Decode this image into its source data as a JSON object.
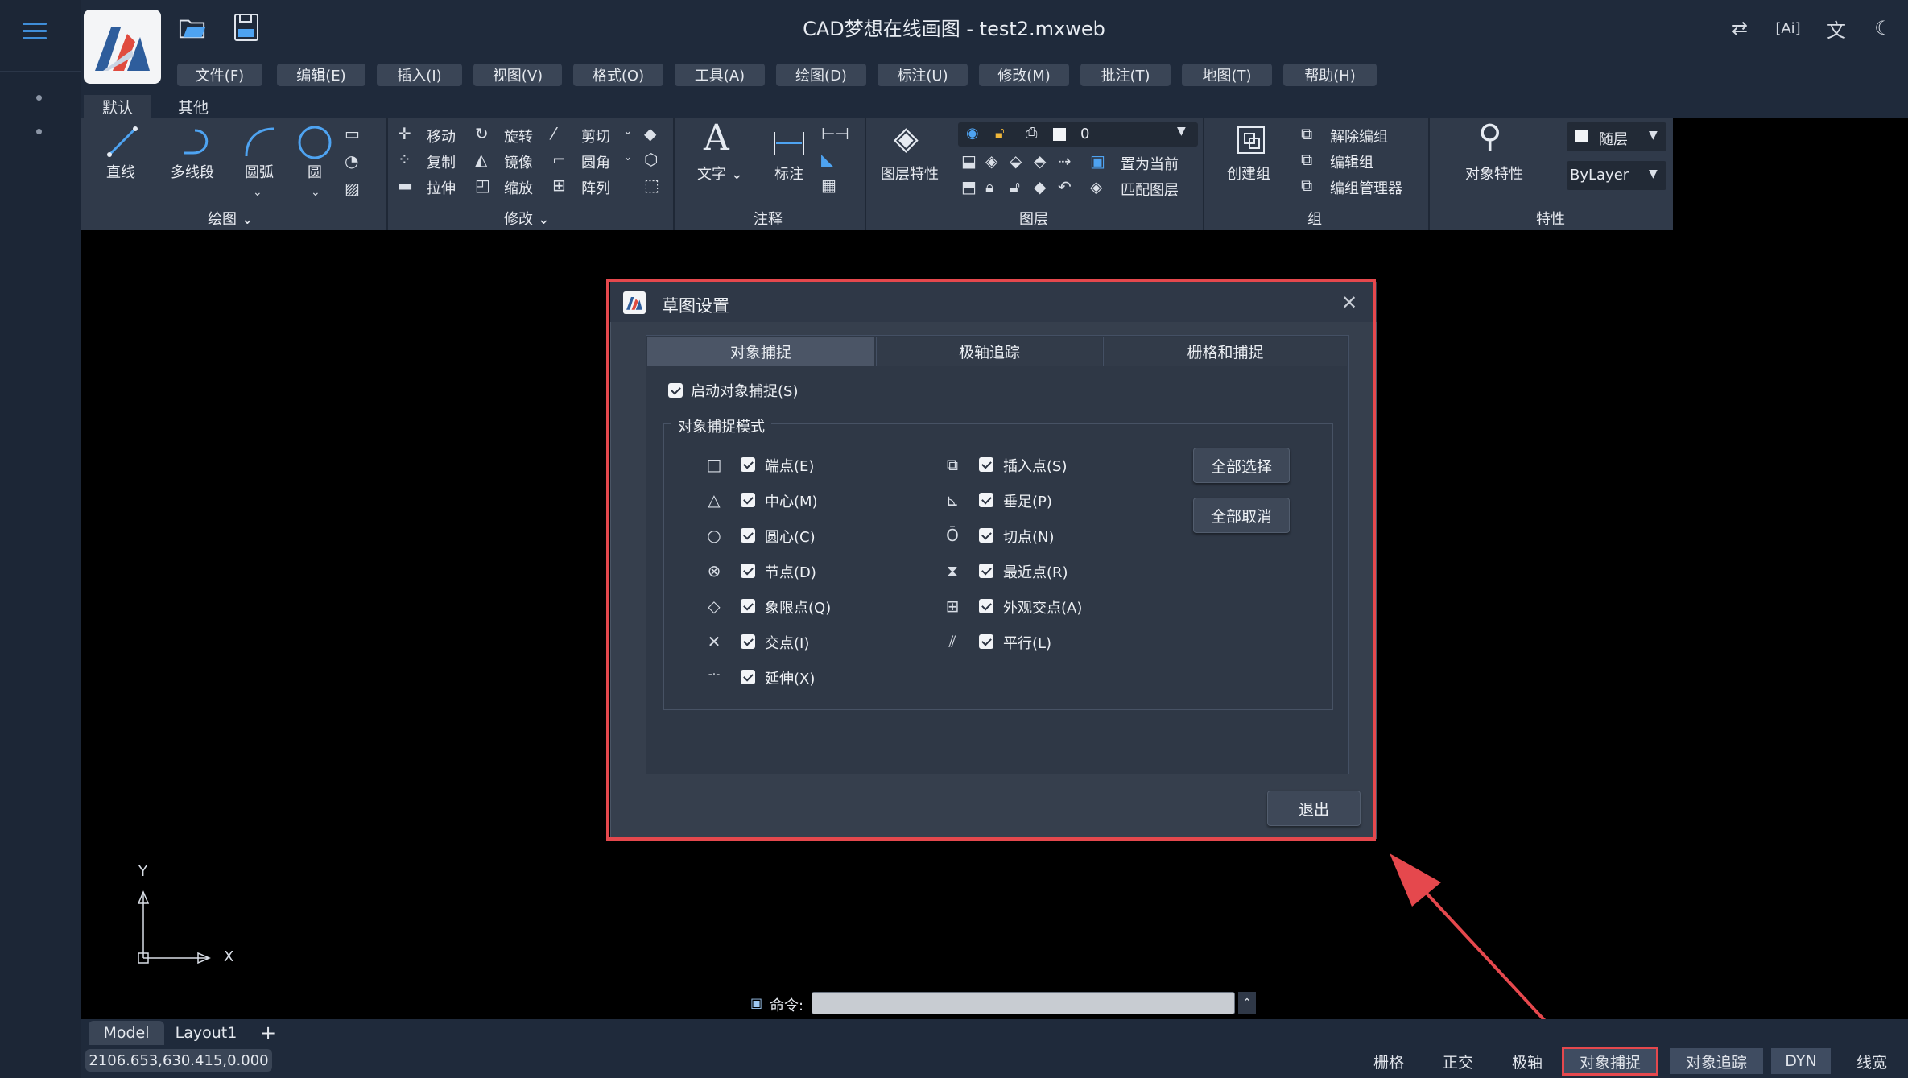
{
  "app": {
    "title": "CAD梦想在线画图 - test2.mxweb"
  },
  "menu": [
    {
      "label": "文件(F)"
    },
    {
      "label": "编辑(E)"
    },
    {
      "label": "插入(I)"
    },
    {
      "label": "视图(V)"
    },
    {
      "label": "格式(O)"
    },
    {
      "label": "工具(A)"
    },
    {
      "label": "绘图(D)"
    },
    {
      "label": "标注(U)"
    },
    {
      "label": "修改(M)"
    },
    {
      "label": "批注(T)"
    },
    {
      "label": "地图(T)"
    },
    {
      "label": "帮助(H)"
    }
  ],
  "ribbon_tabs": [
    "默认",
    "其他"
  ],
  "ribbon": {
    "draw": {
      "line": "直线",
      "polyline": "多线段",
      "arc": "圆弧",
      "circle": "圆",
      "group_label": "绘图"
    },
    "modify": {
      "move": "移动",
      "copy": "复制",
      "stretch": "拉伸",
      "rotate": "旋转",
      "mirror": "镜像",
      "scale": "缩放",
      "trim": "剪切",
      "fillet": "圆角",
      "array": "阵列",
      "group_label": "修改"
    },
    "annotate": {
      "text": "文字",
      "dimension": "标注",
      "group_label": "注释"
    },
    "layers": {
      "layer_props": "图层特性",
      "current_layer": "0",
      "set_current": "置为当前",
      "match_layer": "匹配图层",
      "group_label": "图层"
    },
    "groups": {
      "create_group": "创建组",
      "ungroup": "解除编组",
      "edit_group": "编辑组",
      "group_manager": "编组管理器",
      "group_label": "组"
    },
    "properties": {
      "object_props": "对象特性",
      "color_value": "随层",
      "linetype_value": "ByLayer",
      "group_label": "特性"
    }
  },
  "dialog": {
    "title": "草图设置",
    "tabs": [
      "对象捕捉",
      "极轴追踪",
      "栅格和捕捉"
    ],
    "enable_snap": {
      "label": "启动对象捕捉(S)",
      "checked": true
    },
    "fieldset_label": "对象捕捉模式",
    "left_modes": [
      {
        "label": "端点(E)",
        "icon": "square-icon",
        "glyph": "□",
        "checked": true
      },
      {
        "label": "中心(M)",
        "icon": "triangle-icon",
        "glyph": "△",
        "checked": true
      },
      {
        "label": "圆心(C)",
        "icon": "circle-icon",
        "glyph": "○",
        "checked": true
      },
      {
        "label": "节点(D)",
        "icon": "circled-x-icon",
        "glyph": "⊗",
        "checked": true
      },
      {
        "label": "象限点(Q)",
        "icon": "diamond-icon",
        "glyph": "◇",
        "checked": true
      },
      {
        "label": "交点(I)",
        "icon": "x-icon",
        "glyph": "✕",
        "checked": true
      },
      {
        "label": "延伸(X)",
        "icon": "extension-icon",
        "glyph": "-·-",
        "checked": true
      }
    ],
    "right_modes": [
      {
        "label": "插入点(S)",
        "icon": "insert-icon",
        "glyph": "⧉",
        "checked": true
      },
      {
        "label": "垂足(P)",
        "icon": "perpendicular-icon",
        "glyph": "⊾",
        "checked": true
      },
      {
        "label": "切点(N)",
        "icon": "tangent-icon",
        "glyph": "Ō",
        "checked": true
      },
      {
        "label": "最近点(R)",
        "icon": "nearest-icon",
        "glyph": "⧗",
        "checked": true
      },
      {
        "label": "外观交点(A)",
        "icon": "apparent-intersection-icon",
        "glyph": "⊞",
        "checked": true
      },
      {
        "label": "平行(L)",
        "icon": "parallel-icon",
        "glyph": "⫽",
        "checked": true
      }
    ],
    "select_all": "全部选择",
    "deselect_all": "全部取消",
    "exit": "退出"
  },
  "ucs": {
    "x": "X",
    "y": "Y"
  },
  "command": {
    "label": "命令:",
    "value": ""
  },
  "layout_tabs": [
    "Model",
    "Layout1",
    "+"
  ],
  "coordinates": "2106.653,630.415,0.000",
  "status_toggles": [
    "栅格",
    "正交",
    "极轴",
    "对象捕捉",
    "对象追踪",
    "DYN",
    "线宽"
  ],
  "colors": {
    "highlight": "#e5484d",
    "accent": "#3f8dd8"
  }
}
